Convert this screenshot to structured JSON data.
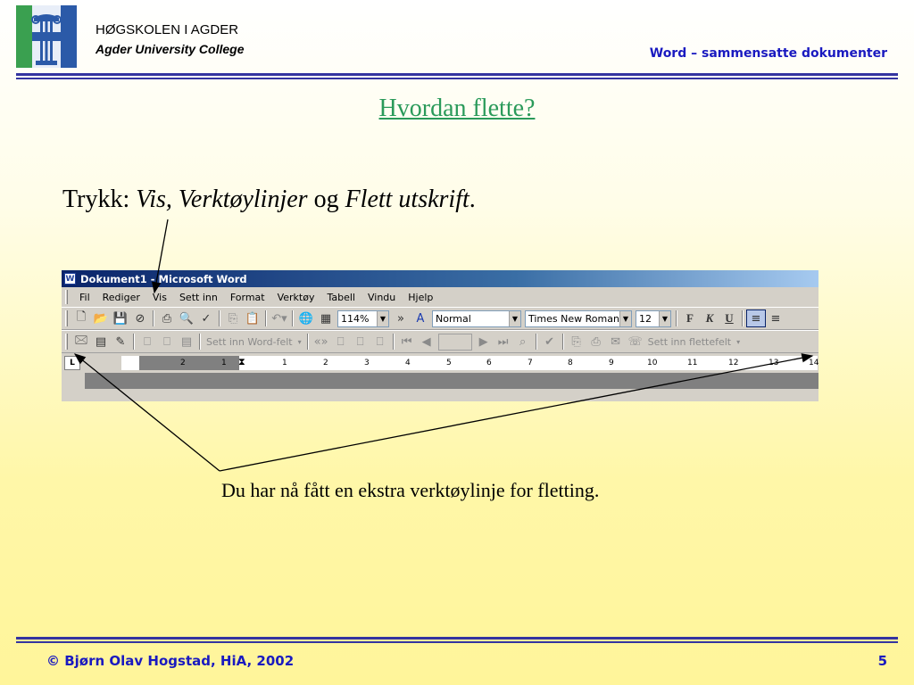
{
  "header": {
    "school_name": "HØGSKOLEN I AGDER",
    "school_subtitle": "Agder University College",
    "slide_topic": "Word – sammensatte dokumenter"
  },
  "slide": {
    "title": "Hvordan flette?",
    "instruction_prefix": "Trykk: ",
    "instruction_vis": "Vis, Verktøylinjer",
    "instruction_og": " og ",
    "instruction_flett": "Flett utskrift",
    "instruction_end": ".",
    "caption": "Du har nå fått en ekstra verktøylinje for fletting."
  },
  "footer": {
    "copyright": "© Bjørn Olav Hogstad, HiA, 2002",
    "page_number": "5"
  },
  "word": {
    "window_title": "Dokument1 - Microsoft Word",
    "menu": [
      "Fil",
      "Rediger",
      "Vis",
      "Sett inn",
      "Format",
      "Verktøy",
      "Tabell",
      "Vindu",
      "Hjelp"
    ],
    "zoom": "114%",
    "style": "Normal",
    "font": "Times New Roman",
    "font_size": "12",
    "bold": "F",
    "italic": "K",
    "underline": "U",
    "insert_word_field": "Sett inn Word-felt",
    "insert_merge_field": "Sett inn flettefelt",
    "ruler_numbers": [
      "2",
      "1",
      "1",
      "2",
      "3",
      "4",
      "5",
      "6",
      "7",
      "8",
      "9",
      "10",
      "11",
      "12",
      "13",
      "14"
    ],
    "tab_marker": "L"
  },
  "colors": {
    "title_green": "#2a9a5a",
    "accent_blue": "#1a1ac0",
    "rule_blue": "#3434a0",
    "logo_green": "#3aa050",
    "logo_blue": "#2b5aa8"
  }
}
